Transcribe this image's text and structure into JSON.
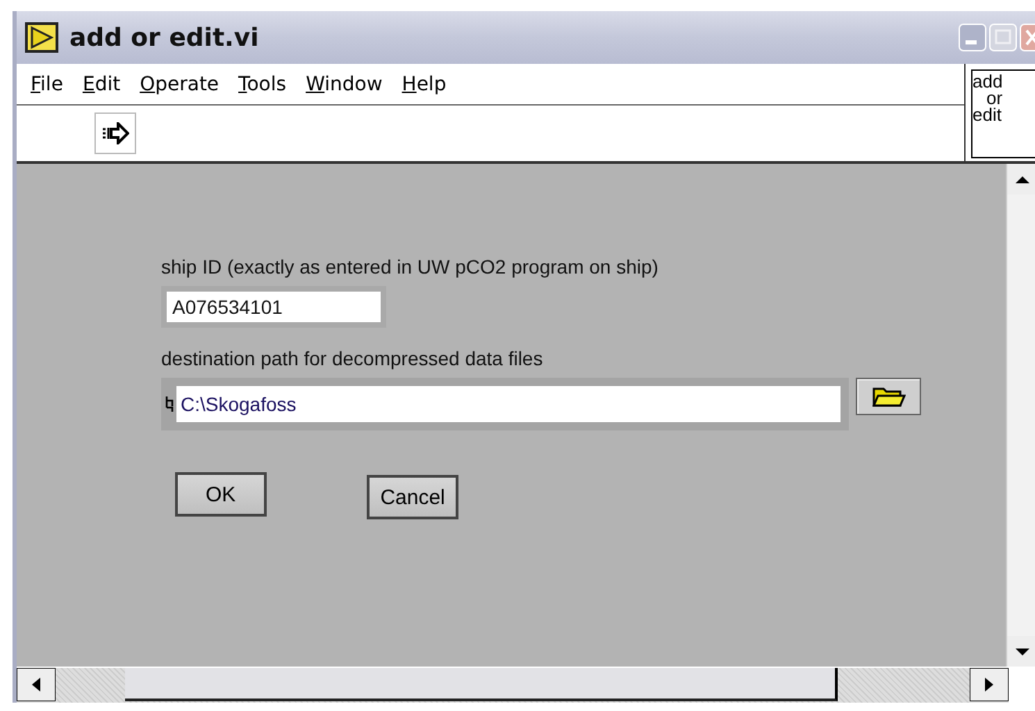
{
  "window": {
    "title": "add or edit.vi"
  },
  "menu": [
    "File",
    "Edit",
    "Operate",
    "Tools",
    "Window",
    "Help"
  ],
  "vi_icon": {
    "lines": [
      "add",
      "or",
      "edit"
    ]
  },
  "form": {
    "ship_id": {
      "label": "ship ID (exactly as entered in UW pCO2 program on ship)",
      "value": "A076534101"
    },
    "path": {
      "label": "destination path for decompressed data files",
      "value": "C:\\Skogafoss"
    },
    "buttons": [
      "OK",
      "Cancel"
    ]
  }
}
